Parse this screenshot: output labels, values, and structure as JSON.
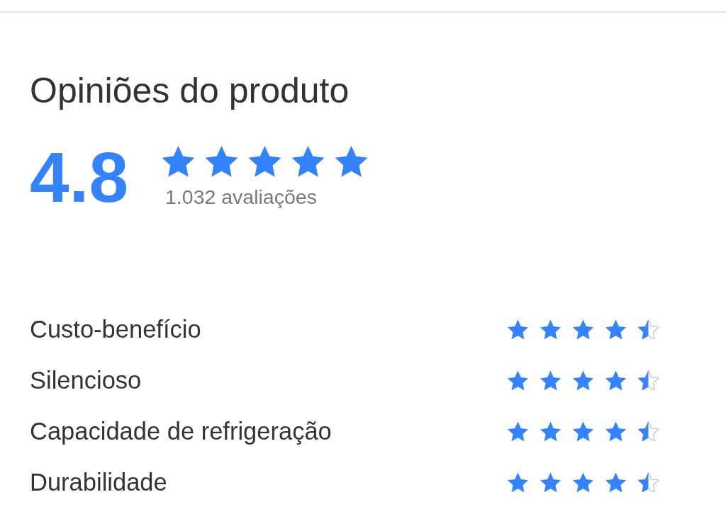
{
  "title": "Opiniões do produto",
  "summary": {
    "average": "4.8",
    "stars": 5,
    "count": "1.032 avaliações"
  },
  "attributes": [
    {
      "label": "Custo-benefício",
      "stars": 4.5
    },
    {
      "label": "Silencioso",
      "stars": 4.5
    },
    {
      "label": "Capacidade de refrigeração",
      "stars": 4.5
    },
    {
      "label": "Durabilidade",
      "stars": 4.5
    }
  ]
}
